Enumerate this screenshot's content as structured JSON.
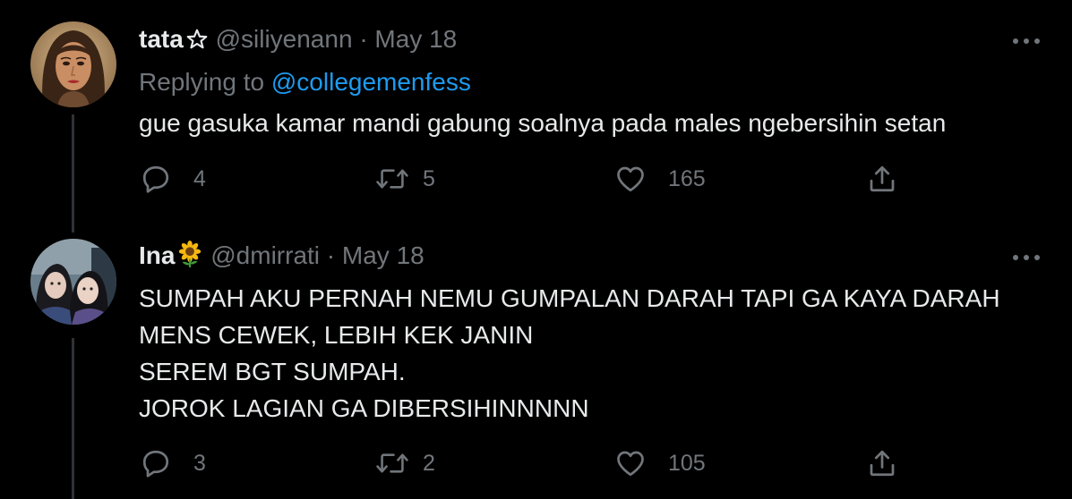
{
  "tweets": [
    {
      "display_name": "tata",
      "name_emoji": "star-outline",
      "handle": "@siliyenann",
      "separator": "·",
      "date": "May 18",
      "replying_label": "Replying to",
      "replying_mention": "@collegemenfess",
      "body_lines": [
        "gue gasuka kamar mandi gabung soalnya pada males ngebersihin setan"
      ],
      "reply_count": "4",
      "retweet_count": "5",
      "like_count": "165"
    },
    {
      "display_name": "Ina",
      "name_emoji": "sunflower",
      "handle": "@dmirrati",
      "separator": "·",
      "date": "May 18",
      "body_lines": [
        "SUMPAH AKU PERNAH NEMU GUMPALAN DARAH TAPI GA KAYA DARAH",
        "MENS CEWEK, LEBIH KEK JANIN",
        "SEREM BGT SUMPAH.",
        "JOROK LAGIAN GA DIBERSIHINNNNN"
      ],
      "reply_count": "3",
      "retweet_count": "2",
      "like_count": "105"
    }
  ],
  "icons": {
    "reply": "speech-bubble-icon",
    "retweet": "retweet-arrows-icon",
    "like": "heart-outline-icon",
    "share": "share-upload-icon",
    "more": "three-dots-icon"
  },
  "colors": {
    "background": "#000000",
    "primary_text": "#e7e9ea",
    "secondary_text": "#71767b",
    "link": "#1d9bf0",
    "thread_line": "#2f3336"
  }
}
